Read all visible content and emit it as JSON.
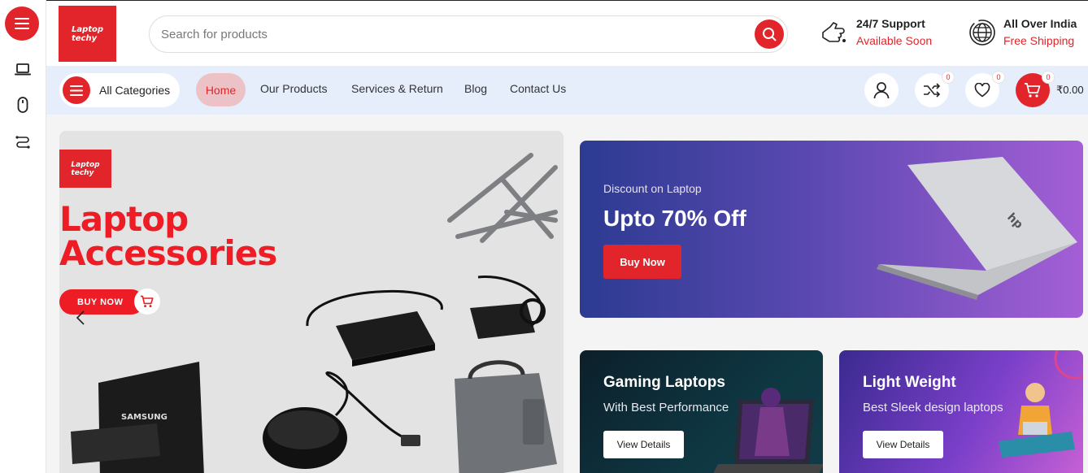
{
  "brand": {
    "logo_text_line1": "Laptop",
    "logo_text_line2": "techy"
  },
  "search": {
    "placeholder": "Search for products"
  },
  "header_info": [
    {
      "title": "24/7 Support",
      "subtitle": "Available Soon",
      "icon": "support-hand-icon"
    },
    {
      "title": "All Over India",
      "subtitle": "Free Shipping",
      "icon": "globe-icon"
    }
  ],
  "nav": {
    "categories_label": "All Categories",
    "links": [
      "Home",
      "Our Products",
      "Services & Return",
      "Blog",
      "Contact Us"
    ],
    "active": "Home",
    "compare_count": "0",
    "wishlist_count": "0",
    "cart_count": "0",
    "cart_total": "₹0.00"
  },
  "hero": {
    "title_line1": "Laptop",
    "title_line2": "Accessories",
    "buy_label": "BUY NOW",
    "product_label_ssd": "SAMSUNG"
  },
  "promos": {
    "laptop": {
      "subtitle": "Discount on Laptop",
      "title": "Upto 70% Off",
      "button": "Buy Now"
    },
    "gaming": {
      "title": "Gaming Laptops",
      "subtitle": "With Best Performance",
      "button": "View Details"
    },
    "light": {
      "title": "Light Weight",
      "subtitle": "Best Sleek design laptops",
      "button": "View Details"
    }
  },
  "colors": {
    "accent": "#e1252a",
    "nav_bg": "#e6eefb",
    "home_pill": "#ecc2c7"
  }
}
